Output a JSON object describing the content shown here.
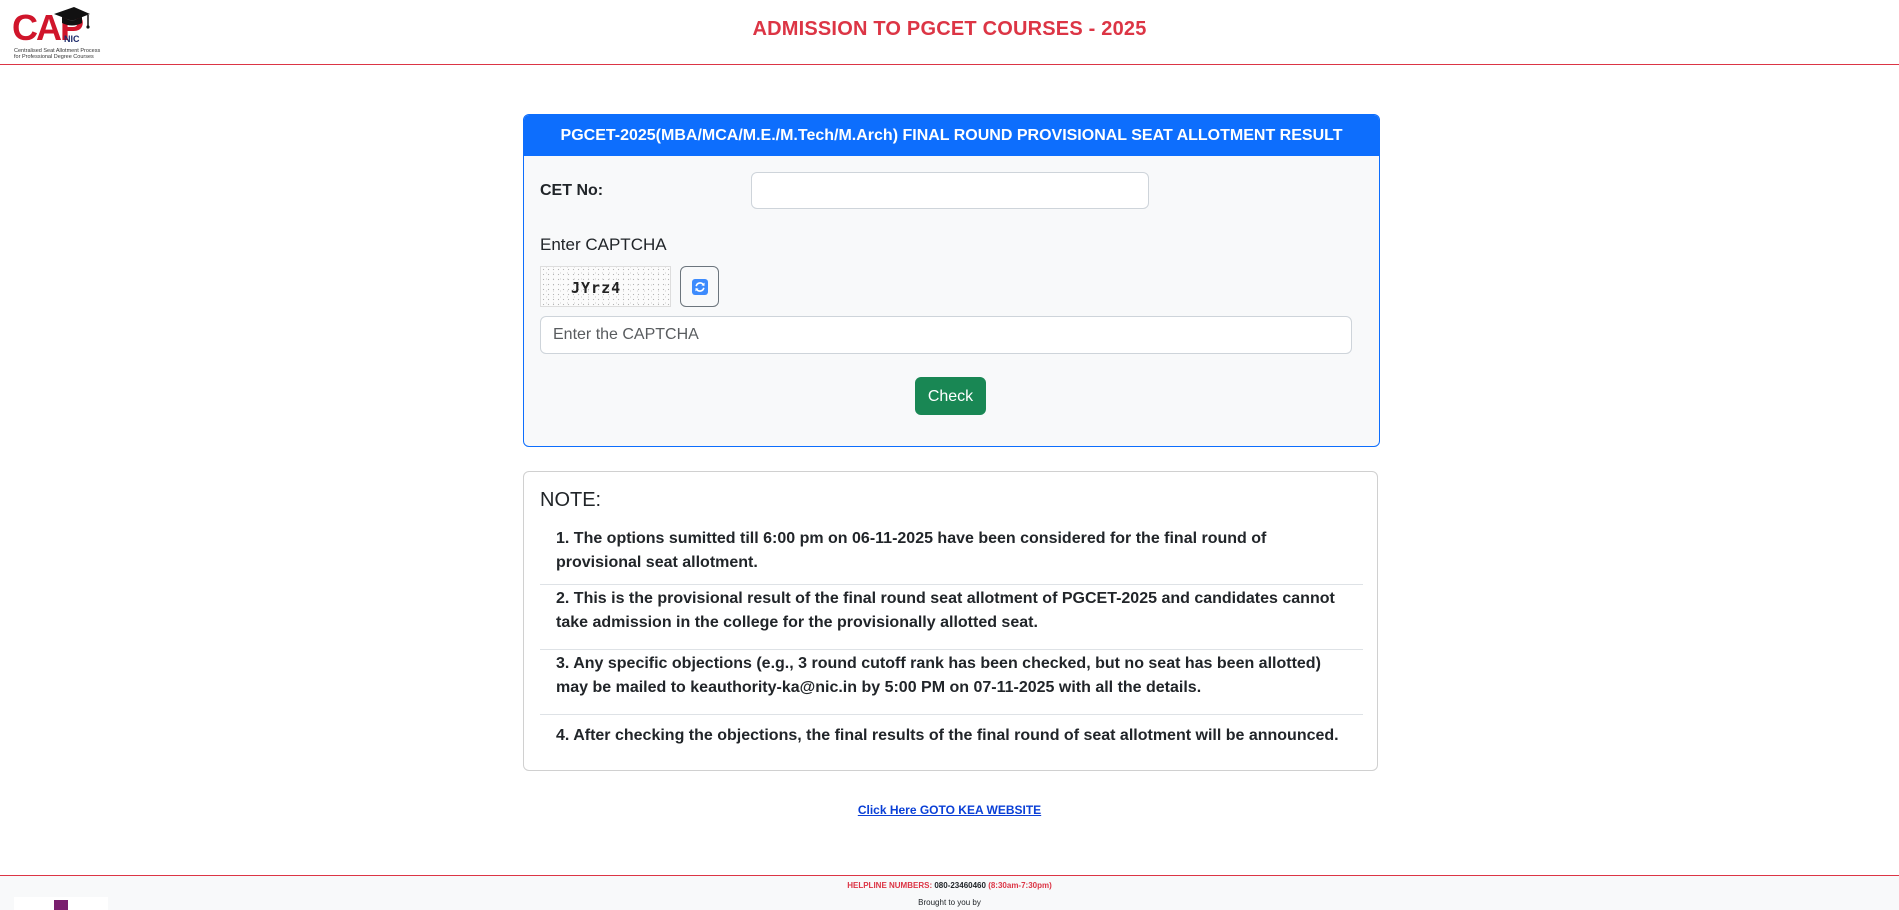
{
  "header": {
    "logo_text": "CAP",
    "logo_sub": "NIC",
    "logo_tagline_1": "Centralised Seat Allotment Process",
    "logo_tagline_2": "for Professional Degree Courses",
    "title": "ADMISSION TO PGCET COURSES - 2025"
  },
  "form": {
    "heading": "PGCET-2025(MBA/MCA/M.E./M.Tech/M.Arch) FINAL ROUND PROVISIONAL SEAT ALLOTMENT RESULT",
    "cet_label": "CET No:",
    "cet_value": "",
    "captcha_label": "Enter CAPTCHA",
    "captcha_code": "JYrz4",
    "refresh_icon": "refresh-icon",
    "captcha_placeholder": "Enter the CAPTCHA",
    "captcha_value": "",
    "check_label": "Check"
  },
  "note": {
    "title": "NOTE:",
    "items": [
      "1. The options sumitted till 6:00 pm on 06-11-2025 have been considered for the final round of provisional seat allotment.",
      "2. This is the provisional result of the final round seat allotment of PGCET-2025 and candidates cannot take admission in the college for the provisionally allotted seat.",
      "3. Any specific objections (e.g., 3 round cutoff rank has been checked, but no seat has been allotted) may be mailed to keauthority-ka@nic.in by 5:00 PM on 07-11-2025 with all the details.",
      "4. After checking the objections, the final results of the final round of seat allotment will be announced."
    ]
  },
  "link": {
    "label": "Click Here GOTO KEA WEBSITE"
  },
  "footer": {
    "helpline_label": "HELPLINE NUMBERS:",
    "helpline_number": "080-23460460",
    "helpline_hours": "(8:30am-7:30pm)",
    "brought_by": "Brought to you by"
  },
  "colors": {
    "title_red": "#dc3545",
    "primary_blue": "#0d6efd",
    "check_green": "#198754",
    "link_blue": "#0a3fd6"
  }
}
